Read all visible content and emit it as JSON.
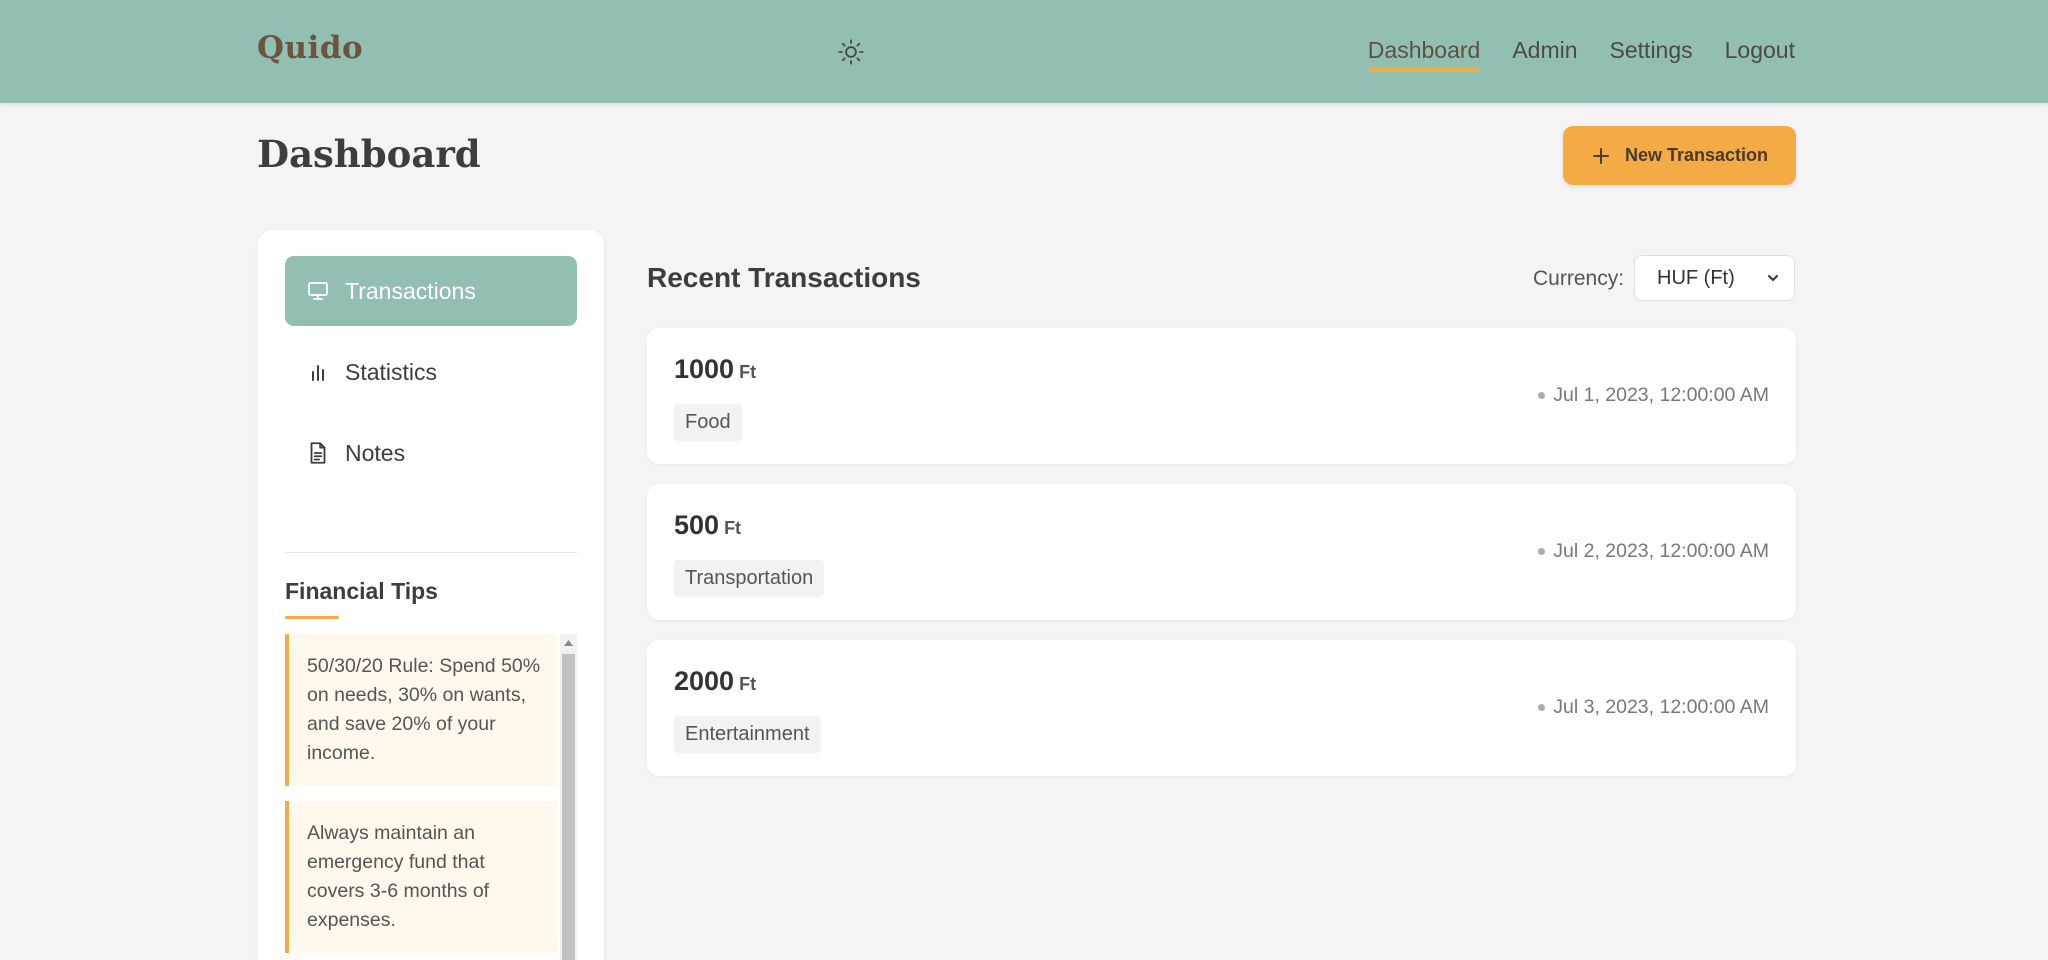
{
  "header": {
    "brand": "Quido",
    "theme_icon": "sun-icon",
    "nav": [
      {
        "label": "Dashboard",
        "active": true
      },
      {
        "label": "Admin",
        "active": false
      },
      {
        "label": "Settings",
        "active": false
      },
      {
        "label": "Logout",
        "active": false
      }
    ]
  },
  "page": {
    "title": "Dashboard",
    "new_button": {
      "label": "New Transaction",
      "icon": "plus-icon"
    }
  },
  "sidebar": {
    "items": [
      {
        "label": "Transactions",
        "icon": "monitor-icon",
        "active": true
      },
      {
        "label": "Statistics",
        "icon": "bar-chart-icon",
        "active": false
      },
      {
        "label": "Notes",
        "icon": "document-icon",
        "active": false
      }
    ],
    "tips_title": "Financial Tips",
    "tips": [
      "50/30/20 Rule: Spend 50% on needs, 30% on wants, and save 20% of your income.",
      "Always maintain an emergency fund that covers 3-6 months of expenses."
    ]
  },
  "main": {
    "title": "Recent Transactions",
    "currency_label": "Currency:",
    "currency_value": "HUF (Ft)",
    "transactions": [
      {
        "amount": "1000",
        "unit": "Ft",
        "category": "Food",
        "date": "Jul 1, 2023, 12:00:00 AM"
      },
      {
        "amount": "500",
        "unit": "Ft",
        "category": "Transportation",
        "date": "Jul 2, 2023, 12:00:00 AM"
      },
      {
        "amount": "2000",
        "unit": "Ft",
        "category": "Entertainment",
        "date": "Jul 3, 2023, 12:00:00 AM"
      }
    ]
  },
  "colors": {
    "header_bg": "#93bfb2",
    "accent": "#f5ab45",
    "brand": "#6b5440",
    "tip_bg": "#fff8ec"
  }
}
